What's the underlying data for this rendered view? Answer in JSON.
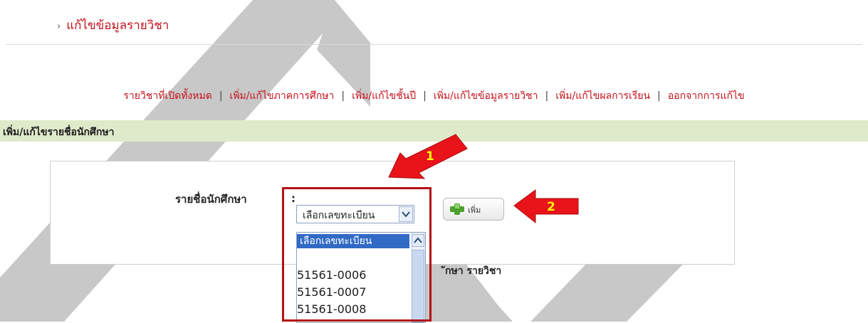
{
  "header": {
    "title": "แก้ไขข้อมูลรายวิชา",
    "bullet": "›"
  },
  "nav": {
    "items": [
      "รายวิชาที่เปิดทั้งหมด",
      "เพิ่ม/แก้ไขภาคการศึกษา",
      "เพิ่ม/แก้ไขชั้นปี",
      "เพิ่ม/แก้ไขข้อมูลรายวิชา",
      "เพิ่ม/แก้ไขผลการเรียน",
      "ออกจากการแก้ไข"
    ],
    "separator": "|"
  },
  "section": {
    "title": "เพิ่ม/แก้ไขรายชื่อนักศึกษา"
  },
  "form": {
    "label": "รายชื่อนักศึกษา",
    "colon": ":",
    "select_value": "เลือกเลขทะเบียน",
    "dropdown_options": [
      "เลือกเลขทะเบียน",
      "",
      "51561-0006",
      "51561-0007",
      "51561-0008"
    ],
    "add_button_label": "เพิ่ม",
    "subtext": "ักษา รายวิชา"
  },
  "annotations": {
    "arrow1": "1",
    "arrow2": "2"
  },
  "colors": {
    "link_red": "#c4121b",
    "section_green": "#dfeacb",
    "highlight_red": "#b30f15",
    "arrow_red": "#e8141a",
    "arrow_text_yellow": "#ffff00",
    "select_blue": "#316ac5"
  }
}
